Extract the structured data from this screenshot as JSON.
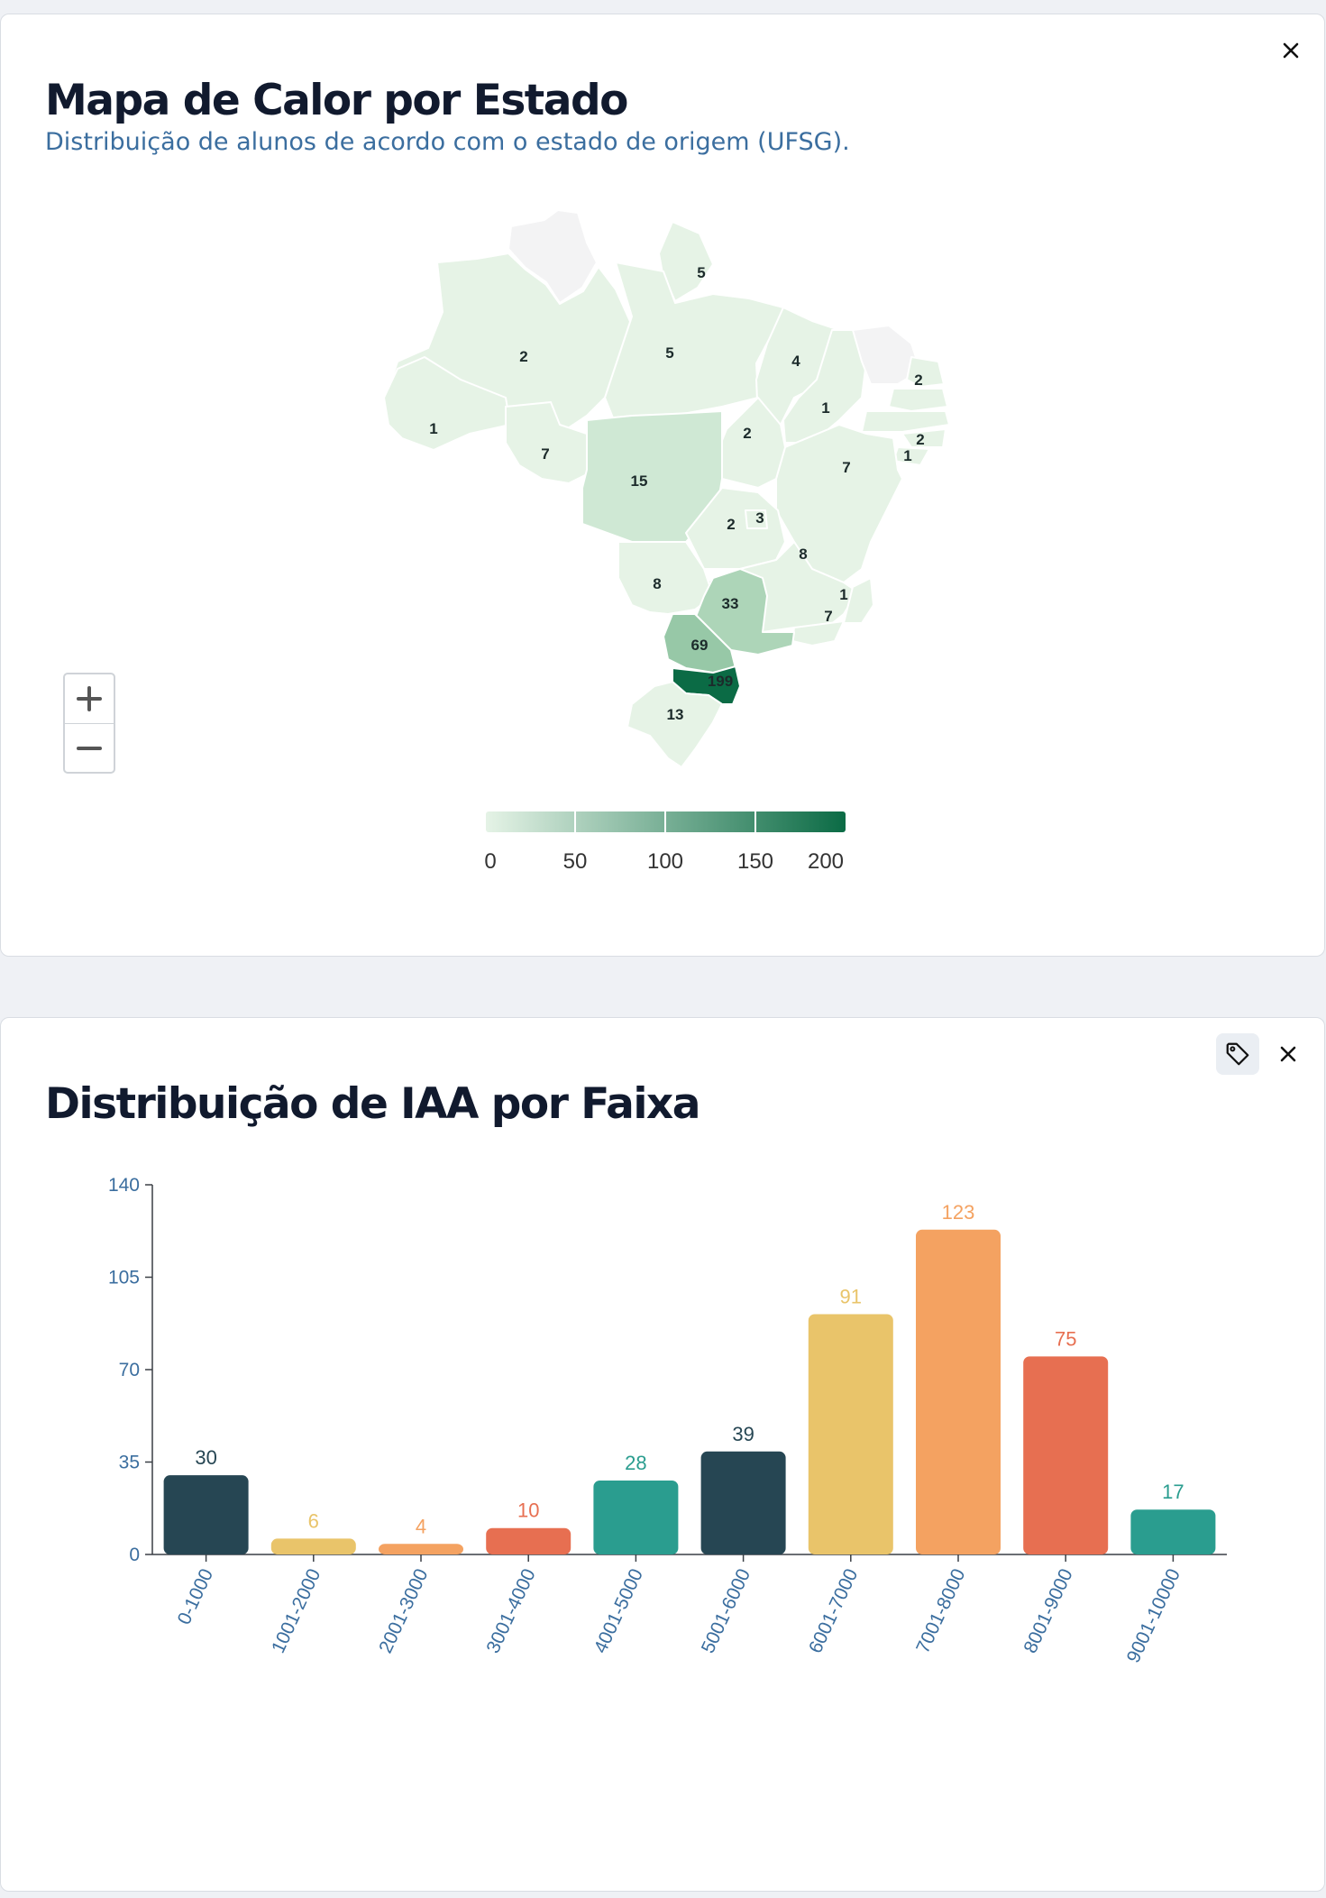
{
  "map_card": {
    "title": "Mapa de Calor por Estado",
    "subtitle": "Distribuição de alunos de acordo com o estado de origem (UFSG).",
    "close_icon": "close-icon",
    "zoom_in_icon": "plus-icon",
    "zoom_out_icon": "minus-icon",
    "state_values": [
      "5",
      "2",
      "5",
      "4",
      "2",
      "1",
      "1",
      "7",
      "2",
      "1",
      "2",
      "15",
      "7",
      "2",
      "3",
      "8",
      "8",
      "1",
      "33",
      "7",
      "69",
      "199",
      "13"
    ],
    "legend": {
      "ticks": [
        "0",
        "50",
        "100",
        "150",
        "200"
      ],
      "color_low": "#e5f3e6",
      "color_high": "#0b6b45"
    }
  },
  "chart_card": {
    "tag_icon": "tag-icon",
    "close_icon": "close-icon"
  },
  "chart_data": {
    "type": "bar",
    "title": "Distribuição de IAA por Faixa",
    "categories": [
      "0-1000",
      "1001-2000",
      "2001-3000",
      "3001-4000",
      "4001-5000",
      "5001-6000",
      "6001-7000",
      "7001-8000",
      "8001-9000",
      "9001-10000"
    ],
    "values": [
      30,
      6,
      4,
      10,
      28,
      39,
      91,
      123,
      75,
      17
    ],
    "colors": [
      "#264653",
      "#e9c46a",
      "#f4a261",
      "#e76f51",
      "#2a9d8f",
      "#264653",
      "#e9c46a",
      "#f4a261",
      "#e76f51",
      "#2a9d8f"
    ],
    "ylim": [
      0,
      140
    ],
    "yticks": [
      "0",
      "35",
      "70",
      "105",
      "140"
    ],
    "xlabel": "",
    "ylabel": ""
  }
}
